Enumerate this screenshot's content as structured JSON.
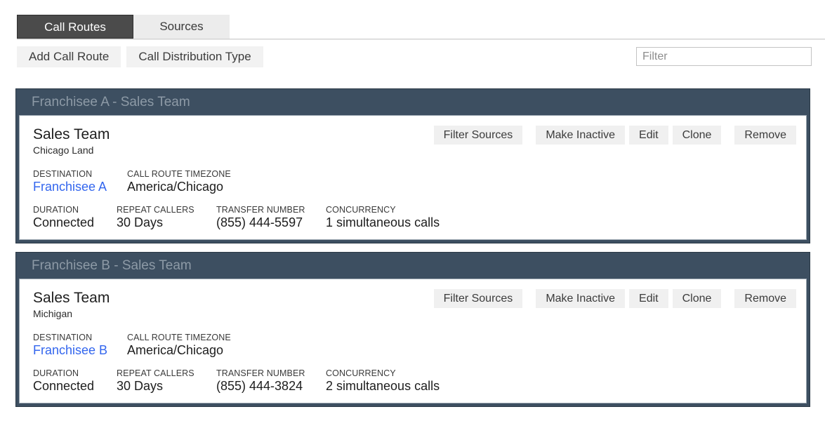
{
  "tabs": [
    {
      "label": "Call Routes",
      "active": true
    },
    {
      "label": "Sources",
      "active": false
    }
  ],
  "toolbar": {
    "add_call_route_label": "Add Call Route",
    "call_distribution_type_label": "Call Distribution Type"
  },
  "search": {
    "placeholder": "Filter",
    "value": ""
  },
  "field_labels": {
    "destination": "DESTINATION",
    "timezone": "CALL ROUTE TIMEZONE",
    "duration": "DURATION",
    "repeat_callers": "REPEAT CALLERS",
    "transfer_number": "TRANSFER NUMBER",
    "concurrency": "CONCURRENCY"
  },
  "actions": {
    "filter_sources": "Filter Sources",
    "make_inactive": "Make Inactive",
    "edit": "Edit",
    "clone": "Clone",
    "remove": "Remove"
  },
  "colors": {
    "card_header_bg": "#3d4f61",
    "card_header_text": "#8d9aa6",
    "link": "#3366ee",
    "tab_active_bg": "#4b4b4b",
    "tab_inactive_bg": "#ececec",
    "button_bg": "#f0f0f0"
  },
  "cards": [
    {
      "header": "Franchisee A - Sales Team",
      "title": "Sales Team",
      "subtitle": "Chicago Land",
      "destination": "Franchisee A",
      "timezone": "America/Chicago",
      "duration": "Connected",
      "repeat_callers": "30 Days",
      "transfer_number": "(855) 444-5597",
      "concurrency": "1 simultaneous calls"
    },
    {
      "header": "Franchisee B - Sales Team",
      "title": "Sales Team",
      "subtitle": "Michigan",
      "destination": "Franchisee B",
      "timezone": "America/Chicago",
      "duration": "Connected",
      "repeat_callers": "30 Days",
      "transfer_number": "(855) 444-3824",
      "concurrency": "2 simultaneous calls"
    }
  ]
}
